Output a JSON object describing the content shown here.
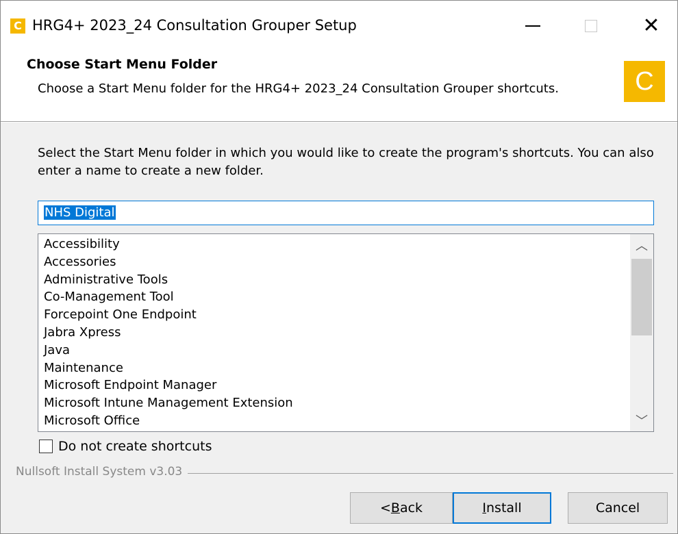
{
  "window": {
    "title": "HRG4+ 2023_24 Consultation Grouper Setup",
    "icon_letter": "C",
    "accent_color": "#f5b800"
  },
  "header": {
    "title": "Choose Start Menu Folder",
    "subtitle": "Choose a Start Menu folder for the HRG4+ 2023_24 Consultation Grouper shortcuts.",
    "icon_letter": "C"
  },
  "body": {
    "instruction": "Select the Start Menu folder in which you would like to create the program's shortcuts. You can also enter a name to create a new folder.",
    "folder_input_value": "NHS Digital",
    "folders": [
      "Accessibility",
      "Accessories",
      "Administrative Tools",
      "Co-Management Tool",
      "Forcepoint One Endpoint",
      "Jabra Xpress",
      "Java",
      "Maintenance",
      "Microsoft Endpoint Manager",
      "Microsoft Intune Management Extension",
      "Microsoft Office"
    ],
    "checkbox_label": "Do not create shortcuts",
    "checkbox_checked": false
  },
  "footer": {
    "branding": "Nullsoft Install System v3.03",
    "back_prefix": "< ",
    "back_mnemonic": "B",
    "back_rest": "ack",
    "install_mnemonic": "I",
    "install_rest": "nstall",
    "cancel_label": "Cancel"
  }
}
